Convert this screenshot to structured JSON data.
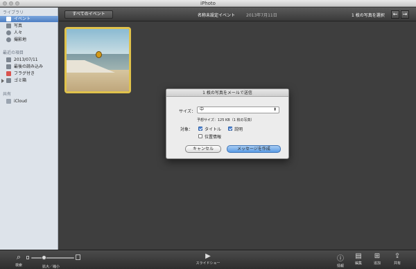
{
  "window": {
    "title": "iPhoto"
  },
  "sidebar": {
    "library_header": "ライブラリ",
    "library_items": [
      {
        "label": "イベント",
        "icon": "events-icon",
        "selected": true
      },
      {
        "label": "写真",
        "icon": "photos-icon"
      },
      {
        "label": "人々",
        "icon": "faces-icon"
      },
      {
        "label": "撮影地",
        "icon": "places-icon"
      }
    ],
    "recent_header": "最近の項目",
    "recent_items": [
      {
        "label": "2013/07/11",
        "icon": "event-icon"
      },
      {
        "label": "最後の読み込み",
        "icon": "import-icon"
      },
      {
        "label": "フラグ付き",
        "icon": "flag-icon"
      },
      {
        "label": "ゴミ箱",
        "icon": "trash-icon"
      }
    ],
    "shared_header": "共有",
    "shared_items": [
      {
        "label": "iCloud",
        "icon": "icloud-icon"
      }
    ]
  },
  "toolbar": {
    "all_events_label": "すべてのイベント",
    "event_title": "名称未設定イベント",
    "event_date": "2013年7月11日",
    "selection_count": "1 枚の写真を選択",
    "prev_arrow": "←",
    "next_arrow": "→"
  },
  "dialog": {
    "title": "1 枚の写真をメールで送信",
    "size_label": "サイズ：",
    "size_value": "中",
    "estimated_size": "予想サイズ：125 KB（1 枚の写真）",
    "target_label": "対象：",
    "options": [
      {
        "label": "タイトル",
        "checked": true
      },
      {
        "label": "説明",
        "checked": true
      },
      {
        "label": "位置情報",
        "checked": false
      }
    ],
    "cancel_label": "キャンセル",
    "create_label": "メッセージを作成"
  },
  "bottom": {
    "search_label": "検索",
    "zoom_label": "拡大／縮小",
    "zoom_level": 0.28,
    "slideshow_label": "スライドショー",
    "info_label": "情報",
    "edit_label": "編集",
    "add_label": "追加",
    "share_label": "共有"
  },
  "colors": {
    "selection": "#4d7ec2",
    "thumb_border": "#e0c24b",
    "primary_button": "#5a9be4"
  }
}
